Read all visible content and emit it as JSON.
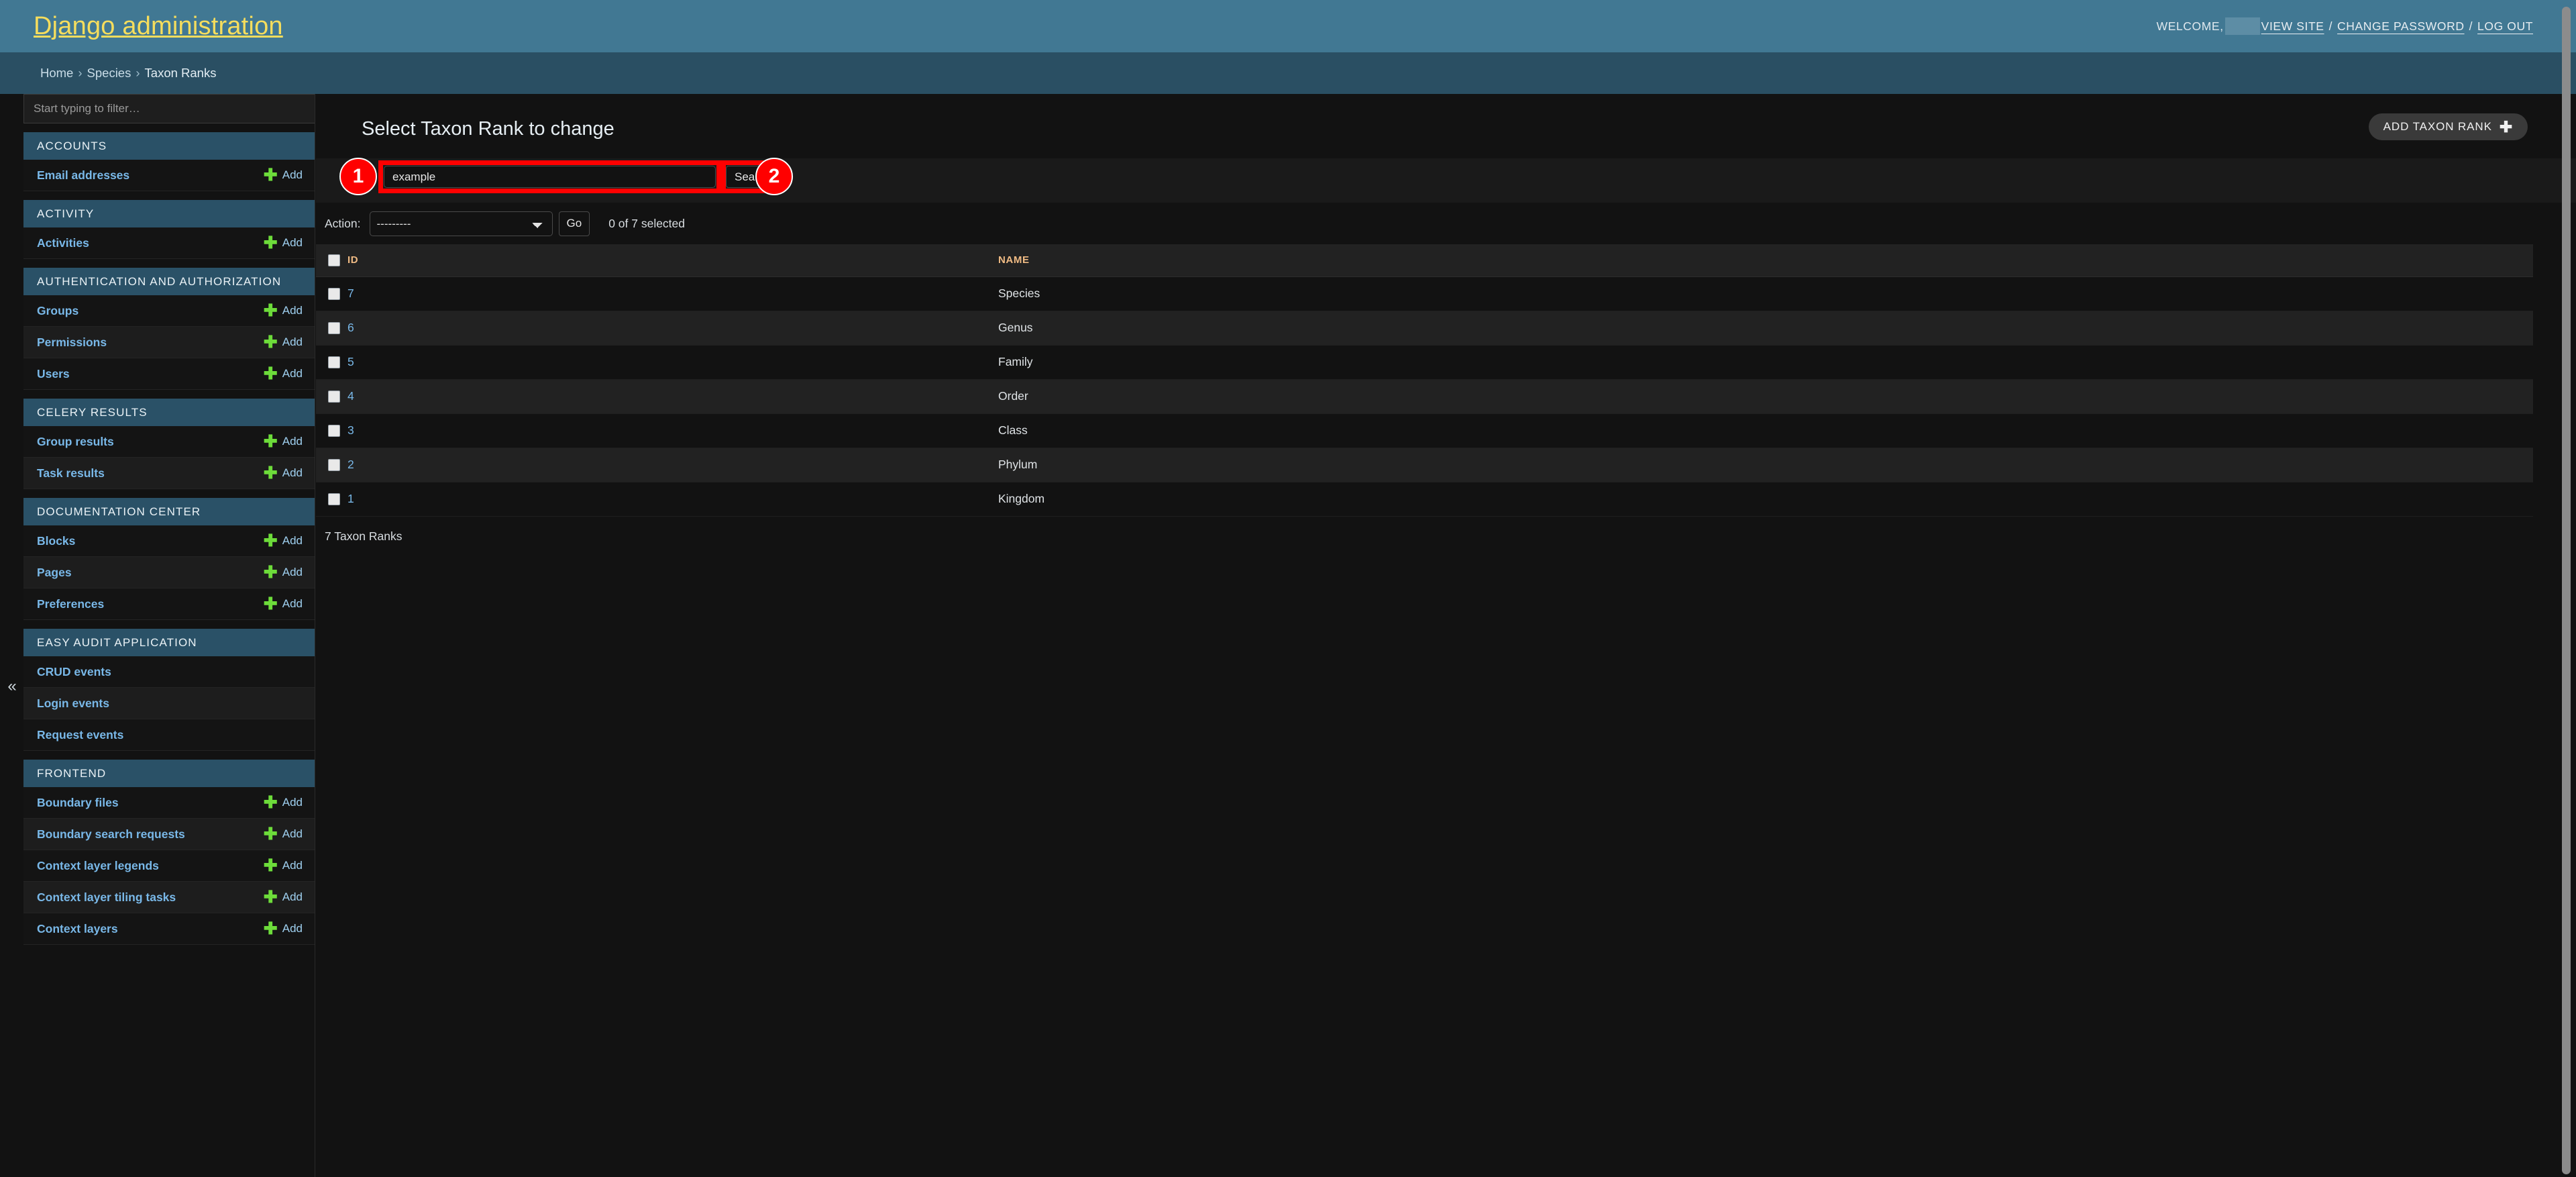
{
  "header": {
    "branding": "Django administration",
    "welcome_label": "WELCOME,",
    "username_redacted": "",
    "links": [
      {
        "label": "VIEW SITE"
      },
      {
        "label": "CHANGE PASSWORD"
      },
      {
        "label": "LOG OUT"
      }
    ],
    "separator": "/"
  },
  "breadcrumbs": {
    "items": [
      {
        "label": "Home"
      },
      {
        "label": "Species"
      },
      {
        "label": "Taxon Ranks"
      }
    ],
    "separator": "›"
  },
  "sidebar": {
    "filter_placeholder": "Start typing to filter…",
    "filter_value": "",
    "collapse_icon": "«",
    "add_label": "Add",
    "apps": [
      {
        "title": "ACCOUNTS",
        "models": [
          {
            "name": "Email addresses",
            "add": true
          }
        ]
      },
      {
        "title": "ACTIVITY",
        "models": [
          {
            "name": "Activities",
            "add": true
          }
        ]
      },
      {
        "title": "AUTHENTICATION AND AUTHORIZATION",
        "models": [
          {
            "name": "Groups",
            "add": true
          },
          {
            "name": "Permissions",
            "add": true
          },
          {
            "name": "Users",
            "add": true
          }
        ]
      },
      {
        "title": "CELERY RESULTS",
        "models": [
          {
            "name": "Group results",
            "add": true
          },
          {
            "name": "Task results",
            "add": true
          }
        ]
      },
      {
        "title": "DOCUMENTATION CENTER",
        "models": [
          {
            "name": "Blocks",
            "add": true
          },
          {
            "name": "Pages",
            "add": true
          },
          {
            "name": "Preferences",
            "add": true
          }
        ]
      },
      {
        "title": "EASY AUDIT APPLICATION",
        "models": [
          {
            "name": "CRUD events",
            "add": false
          },
          {
            "name": "Login events",
            "add": false
          },
          {
            "name": "Request events",
            "add": false
          }
        ]
      },
      {
        "title": "FRONTEND",
        "models": [
          {
            "name": "Boundary files",
            "add": true
          },
          {
            "name": "Boundary search requests",
            "add": true
          },
          {
            "name": "Context layer legends",
            "add": true
          },
          {
            "name": "Context layer tiling tasks",
            "add": true
          },
          {
            "name": "Context layers",
            "add": true
          }
        ]
      }
    ]
  },
  "main": {
    "page_title": "Select Taxon Rank to change",
    "add_button_label": "ADD TAXON RANK",
    "add_button_icon": "plus-icon",
    "search": {
      "value": "example",
      "placeholder": "",
      "submit_label": "Search"
    },
    "actions": {
      "label": "Action:",
      "selected": "---------",
      "options": [
        "---------"
      ],
      "go_label": "Go",
      "counter": "0 of 7 selected"
    },
    "table": {
      "columns": [
        "",
        "ID",
        "NAME"
      ],
      "rows": [
        {
          "id": "7",
          "name": "Species"
        },
        {
          "id": "6",
          "name": "Genus"
        },
        {
          "id": "5",
          "name": "Family"
        },
        {
          "id": "4",
          "name": "Order"
        },
        {
          "id": "3",
          "name": "Class"
        },
        {
          "id": "2",
          "name": "Phylum"
        },
        {
          "id": "1",
          "name": "Kingdom"
        }
      ]
    },
    "result_count": "7 Taxon Ranks"
  },
  "annotations": [
    {
      "badge": "1",
      "target": "search-input"
    },
    {
      "badge": "2",
      "target": "search-submit-button"
    }
  ],
  "colors": {
    "header_bg": "#417893",
    "breadcrumb_bg": "#2a4f63",
    "body_bg": "#121212",
    "brand_text": "#f5dd5d",
    "app_title_bg": "#2a5167",
    "link_blue": "#79b8e8",
    "add_green": "#6ddc3a",
    "annotation_red": "#ff0000",
    "column_header_text": "#f0bb84"
  }
}
